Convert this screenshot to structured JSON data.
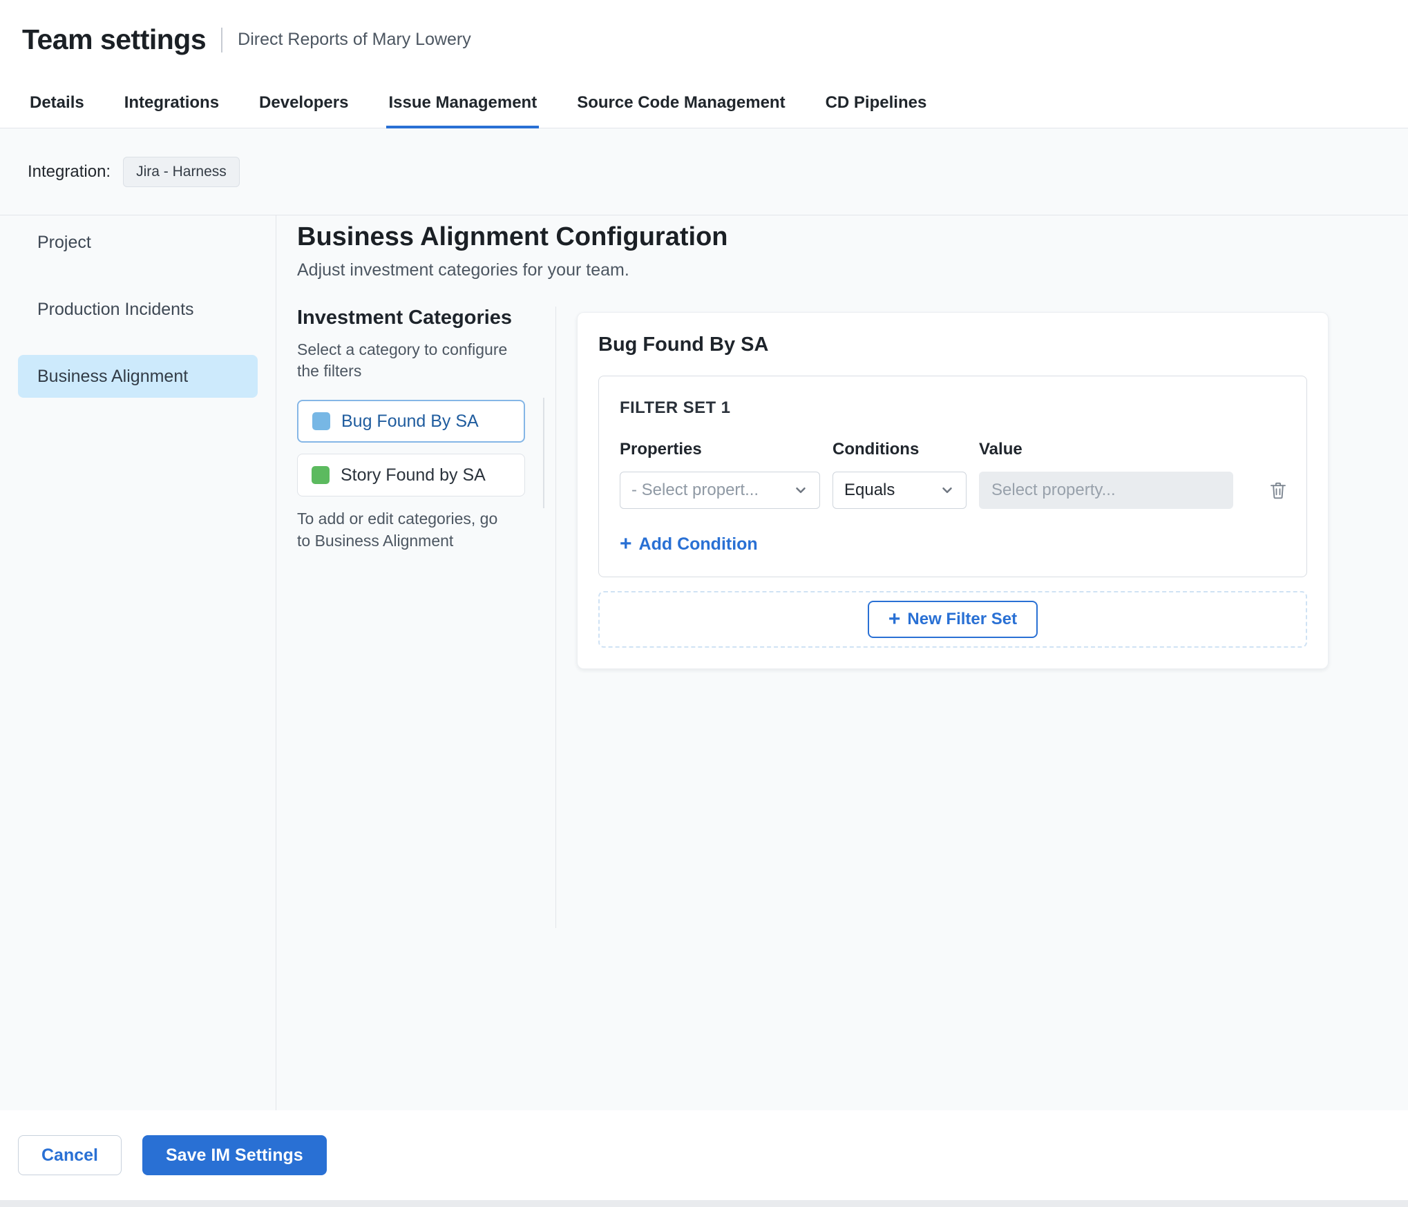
{
  "header": {
    "title": "Team settings",
    "subtitle": "Direct Reports of Mary Lowery"
  },
  "tabs": {
    "items": [
      {
        "label": "Details",
        "active": false
      },
      {
        "label": "Integrations",
        "active": false
      },
      {
        "label": "Developers",
        "active": false
      },
      {
        "label": "Issue Management",
        "active": true
      },
      {
        "label": "Source Code Management",
        "active": false
      },
      {
        "label": "CD Pipelines",
        "active": false
      }
    ]
  },
  "integration": {
    "label": "Integration:",
    "chip": "Jira - Harness"
  },
  "sidebar": {
    "items": [
      {
        "label": "Project",
        "active": false
      },
      {
        "label": "Production Incidents",
        "active": false
      },
      {
        "label": "Business Alignment",
        "active": true
      }
    ]
  },
  "main": {
    "title": "Business Alignment Configuration",
    "subtitle": "Adjust investment categories for your team.",
    "categories": {
      "title": "Investment Categories",
      "hint": "Select a category to configure the filters",
      "items": [
        {
          "label": "Bug Found By SA",
          "swatch_color": "#77b7e5",
          "selected": true
        },
        {
          "label": "Story Found by SA",
          "swatch_color": "#5cba5f",
          "selected": false
        }
      ],
      "footnote": "To add or edit categories, go to Business Alignment"
    },
    "panel": {
      "title": "Bug Found By SA",
      "filter_set": {
        "title": "FILTER SET 1",
        "columns": [
          "Properties",
          "Conditions",
          "Value"
        ],
        "property_placeholder": "- Select propert...",
        "condition_value": "Equals",
        "value_placeholder": "Select property...",
        "add_condition_label": "Add Condition"
      },
      "new_filter_set_label": "New Filter Set"
    }
  },
  "footer": {
    "cancel_label": "Cancel",
    "save_label": "Save IM Settings"
  },
  "icons": {
    "plus": "+",
    "chevron_down": "chevron-down",
    "trash": "trash"
  },
  "colors": {
    "accent": "#2970d4",
    "selected_nav_bg": "#cdeafc",
    "category_selected_border": "#85b6e6",
    "category_swatch_blue": "#77b7e5",
    "category_swatch_green": "#5cba5f"
  }
}
